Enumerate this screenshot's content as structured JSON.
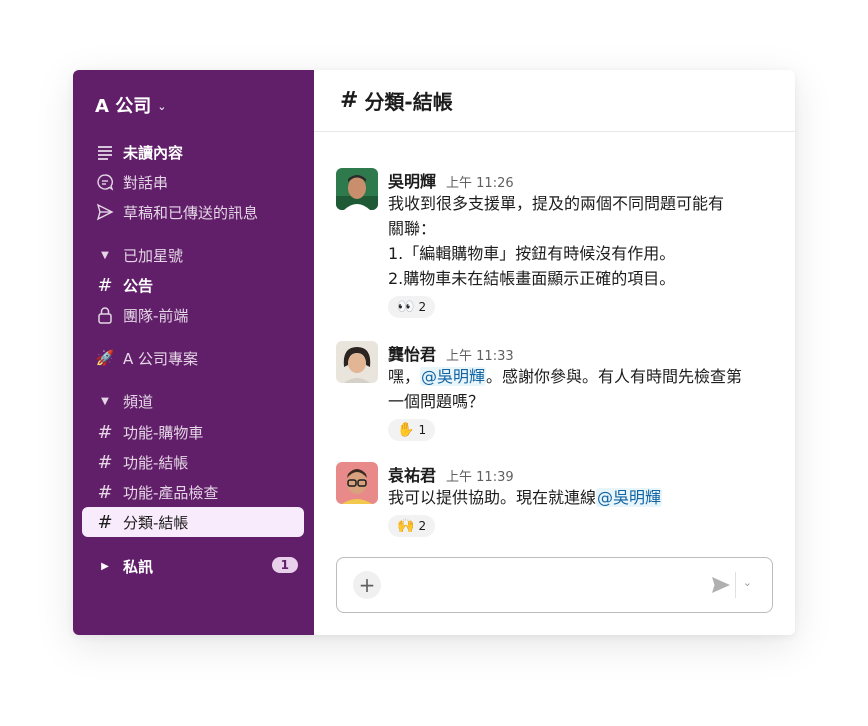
{
  "workspace": {
    "name": "A 公司",
    "menu_icon": "chevron-down-icon"
  },
  "sidebar": {
    "items": [
      {
        "label": "未讀內容",
        "icon": "unreads-icon"
      },
      {
        "label": "對話串",
        "icon": "threads-icon"
      },
      {
        "label": "草稿和已傳送的訊息",
        "icon": "send-icon"
      },
      {
        "label": "已加星號",
        "icon": "caret-down-icon"
      },
      {
        "label": "公告",
        "icon": "hash-icon"
      },
      {
        "label": "團隊-前端",
        "icon": "lock-icon"
      },
      {
        "label": "A 公司專案",
        "icon": "rocket-icon"
      },
      {
        "label": "頻道",
        "icon": "caret-down-icon"
      },
      {
        "label": "功能-購物車",
        "icon": "hash-icon"
      },
      {
        "label": "功能-結帳",
        "icon": "hash-icon"
      },
      {
        "label": "功能-產品檢查",
        "icon": "hash-icon"
      },
      {
        "label": "分類-結帳",
        "icon": "hash-icon"
      },
      {
        "label": "私訊",
        "icon": "caret-right-icon",
        "badge": "1"
      }
    ]
  },
  "channel": {
    "hash": "#",
    "name": "分類-結帳"
  },
  "messages": [
    {
      "author": "吳明輝",
      "time": "上午 11:26",
      "lines": [
        "我收到很多支援單，提及的兩個不同問題可能有",
        "關聯：",
        "1.「編輯購物車」按鈕有時候沒有作用。",
        "2.購物車未在結帳畫面顯示正確的項目。"
      ],
      "reaction": {
        "emoji": "👀",
        "count": "2"
      }
    },
    {
      "author": "龔怡君",
      "time": "上午 11:33",
      "text_pre": "嘿，",
      "mention": "@吳明輝",
      "text_post_1": "。感謝你參與。有人有時間先檢查第",
      "text_post_2": "一個問題嗎？",
      "reaction": {
        "emoji": "✋",
        "count": "1"
      }
    },
    {
      "author": "袁祐君",
      "time": "上午 11:39",
      "text_pre": "我可以提供協助。現在就連線",
      "mention": "@吳明輝",
      "reaction": {
        "emoji": "🙌",
        "count": "2"
      }
    }
  ],
  "composer": {
    "plus": "+",
    "send_icon": "paper-plane-icon",
    "options_icon": "chevron-down-icon"
  },
  "colors": {
    "sidebar": "#611f69",
    "active_item": "#f8ebfb",
    "mention": "#1264a3"
  }
}
